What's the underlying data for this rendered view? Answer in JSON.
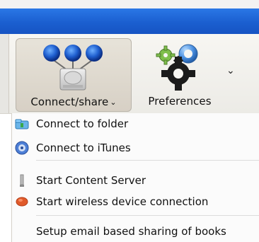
{
  "toolbar": {
    "connect_share_label": "Connect/share",
    "preferences_label": "Preferences"
  },
  "menu": {
    "items": [
      {
        "label": "Connect to folder",
        "icon": "folder-icon"
      },
      {
        "label": "Connect to iTunes",
        "icon": "itunes-icon"
      },
      {
        "label": "Start Content Server",
        "icon": "content-server-icon"
      },
      {
        "label": "Start wireless device connection",
        "icon": "wireless-connection-icon"
      },
      {
        "label": "Setup email based sharing of books",
        "icon": ""
      }
    ]
  },
  "colors": {
    "titlebar_blue": "#1b5fd0",
    "menu_bg": "#fbfbfb",
    "toolbar_bg": "#ecebe6",
    "selected_button_bg": "#d7d0c5"
  }
}
